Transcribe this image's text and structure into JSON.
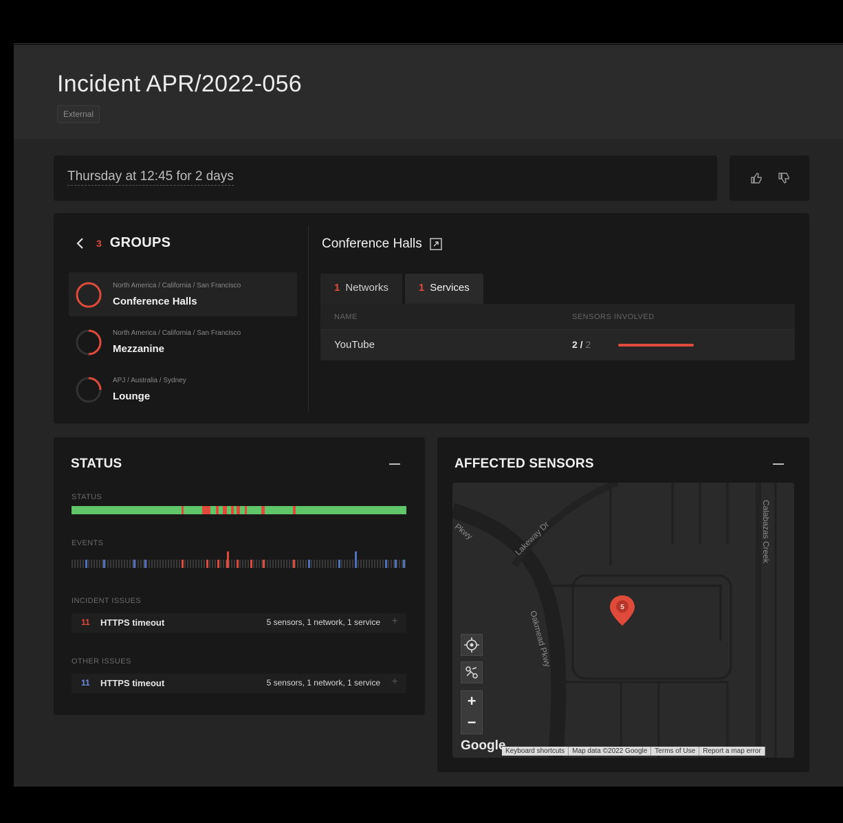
{
  "incident": {
    "title": "Incident APR/2022-056",
    "tag": "External"
  },
  "schedule": {
    "text": "Thursday at 12:45 for 2 days"
  },
  "icons": {
    "thumbs_up": "thumbs-up-icon",
    "thumbs_down": "thumbs-down-icon",
    "back": "chevron-left-icon",
    "external": "external-link-icon",
    "pin": "map-pin-icon"
  },
  "groups": {
    "count": "3",
    "label": "GROUPS",
    "items": [
      {
        "path": "North America / California / San Francisco",
        "name": "Conference Halls",
        "progress": 1.0
      },
      {
        "path": "North America / California / San Francisco",
        "name": "Mezzanine",
        "progress": 0.5
      },
      {
        "path": "APJ / Australia / Sydney",
        "name": "Lounge",
        "progress": 0.25
      }
    ]
  },
  "detail": {
    "title": "Conference Halls",
    "tabs": [
      {
        "count": "1",
        "label": "Networks"
      },
      {
        "count": "1",
        "label": "Services"
      }
    ],
    "columns": {
      "name": "NAME",
      "sensors": "SENSORS INVOLVED"
    },
    "rows": [
      {
        "name": "YouTube",
        "involved": "2",
        "total": "2",
        "ratio": 1.0
      }
    ]
  },
  "status": {
    "title": "STATUS",
    "status_label": "STATUS",
    "events_label": "EVENTS",
    "incident_label": "INCIDENT ISSUES",
    "other_label": "OTHER ISSUES",
    "incident_issues": [
      {
        "count": "11",
        "name": "HTTPS timeout",
        "meta": "5 sensors, 1 network, 1 service",
        "plus": "+"
      }
    ],
    "other_issues": [
      {
        "count": "11",
        "name": "HTTPS timeout",
        "meta": "5 sensors, 1 network, 1 service",
        "plus": "+"
      }
    ]
  },
  "sensors": {
    "title": "AFFECTED SENSORS",
    "map": {
      "streets": [
        "Pkwy",
        "Lakeway Dr",
        "Oakmead Pkwy",
        "Calabazas Creek"
      ],
      "zoom_in": "+",
      "zoom_out": "−",
      "brand": "Google",
      "attribution": [
        "Keyboard shortcuts",
        "Map data ©2022 Google",
        "Terms of Use",
        "Report a map error"
      ],
      "pin_label": "5"
    }
  },
  "colors": {
    "ok": "#5fc76a",
    "alert": "#e04a3a",
    "event": "#4f6fbf",
    "accent_blue": "#6b8de0"
  }
}
